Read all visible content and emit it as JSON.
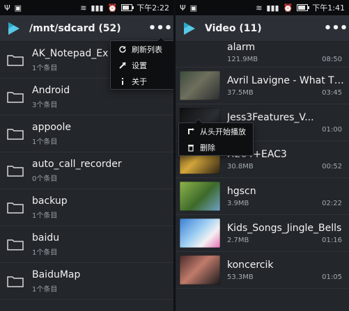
{
  "left_screen": {
    "status": {
      "time": "下午2:22"
    },
    "appbar": {
      "title": "/mnt/sdcard (52)",
      "overflow": "•••"
    },
    "folders": [
      {
        "name": "AK_Notepad_Ex",
        "sub": "1个条目"
      },
      {
        "name": "Android",
        "sub": "3个条目"
      },
      {
        "name": "appoole",
        "sub": "1个条目"
      },
      {
        "name": "auto_call_recorder",
        "sub": "0个条目"
      },
      {
        "name": "backup",
        "sub": "1个条目"
      },
      {
        "name": "baidu",
        "sub": "1个条目"
      },
      {
        "name": "BaiduMap",
        "sub": "1个条目"
      }
    ],
    "menu": {
      "items": [
        {
          "label": "刷新列表",
          "icon": "refresh-icon"
        },
        {
          "label": "设置",
          "icon": "settings-tools-icon"
        },
        {
          "label": "关于",
          "icon": "info-icon"
        }
      ]
    }
  },
  "right_screen": {
    "status": {
      "time": "下午1:41"
    },
    "appbar": {
      "title": "Video (11)",
      "overflow": "•••"
    },
    "videos": [
      {
        "title": "alarm",
        "size": "121.9MB",
        "duration": "08:50",
        "thumb": "none"
      },
      {
        "title": "Avril Lavigne - What Th...",
        "size": "37.5MB",
        "duration": "03:45",
        "thumb": "dark-room"
      },
      {
        "title": "Jess3Features_V...",
        "size": "",
        "duration": "01:00",
        "thumb": "dark"
      },
      {
        "title": "H264+EAC3",
        "size": "30.8MB",
        "duration": "00:52",
        "thumb": "dark-stage"
      },
      {
        "title": "hgscn",
        "size": "3.9MB",
        "duration": "02:22",
        "thumb": "nature"
      },
      {
        "title": "Kids_Songs_Jingle_Bells",
        "size": "2.7MB",
        "duration": "01:16",
        "thumb": "winter"
      },
      {
        "title": "koncercik",
        "size": "53.3MB",
        "duration": "01:05",
        "thumb": "stage"
      }
    ],
    "menu": {
      "items": [
        {
          "label": "从头开始播放",
          "icon": "replay-icon"
        },
        {
          "label": "删除",
          "icon": "trash-icon"
        }
      ]
    }
  },
  "colors": {
    "accent": "#58c9e6",
    "accent_dark": "#2aa7c8"
  }
}
